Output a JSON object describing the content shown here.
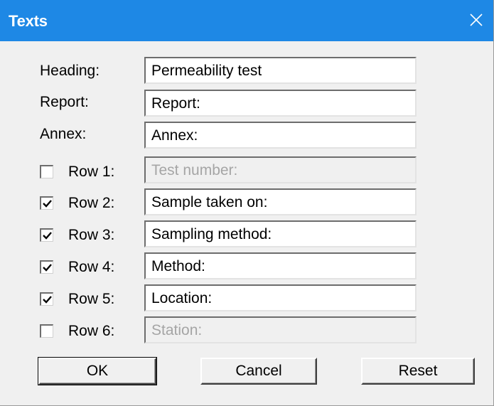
{
  "window": {
    "title": "Texts"
  },
  "fields": {
    "heading": {
      "label": "Heading:",
      "value": "Permeability test"
    },
    "report": {
      "label": "Report:",
      "value": "Report:"
    },
    "annex": {
      "label": "Annex:",
      "value": "Annex:"
    }
  },
  "rows": [
    {
      "label": "Row 1:",
      "checked": false,
      "value": "Test number:",
      "enabled": false
    },
    {
      "label": "Row 2:",
      "checked": true,
      "value": "Sample taken on:",
      "enabled": true
    },
    {
      "label": "Row 3:",
      "checked": true,
      "value": "Sampling method:",
      "enabled": true
    },
    {
      "label": "Row 4:",
      "checked": true,
      "value": "Method:",
      "enabled": true
    },
    {
      "label": "Row 5:",
      "checked": true,
      "value": "Location:",
      "enabled": true
    },
    {
      "label": "Row 6:",
      "checked": false,
      "value": "Station:",
      "enabled": false
    }
  ],
  "buttons": {
    "ok": "OK",
    "cancel": "Cancel",
    "reset": "Reset"
  },
  "colors": {
    "titlebar": "#1e88e5",
    "dialog_bg": "#f0f0f0",
    "disabled_text": "#a5a5a5"
  },
  "icons": {
    "close": "close-icon",
    "check": "check-icon"
  }
}
